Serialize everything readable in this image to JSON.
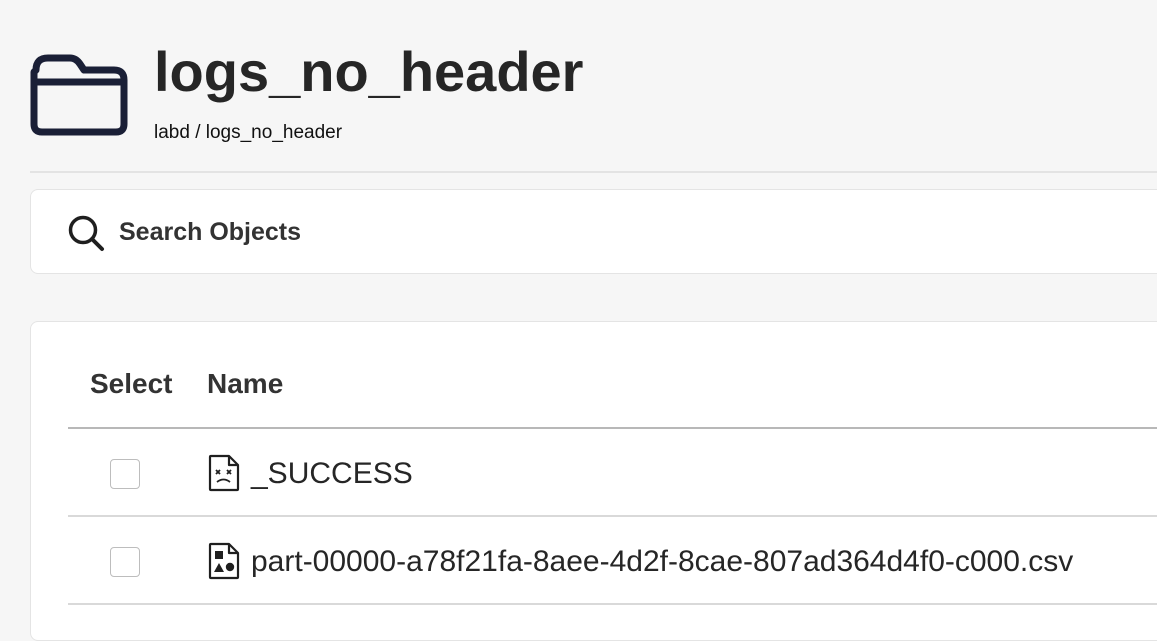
{
  "header": {
    "title": "logs_no_header",
    "breadcrumb": "labd / logs_no_header",
    "icon": "folder-icon"
  },
  "search": {
    "placeholder": "Search Objects",
    "value": "",
    "icon": "search-icon"
  },
  "table": {
    "columns": {
      "select": "Select",
      "name": "Name"
    },
    "rows": [
      {
        "name": "_SUCCESS",
        "icon": "broken-file-icon",
        "selected": false
      },
      {
        "name": "part-00000-a78f21fa-8aee-4d2f-8cae-807ad364d4f0-c000.csv",
        "icon": "media-file-icon",
        "selected": false
      }
    ]
  },
  "colors": {
    "background": "#f6f6f6",
    "card": "#ffffff",
    "text": "#262626",
    "icon": "#1a1f36"
  }
}
